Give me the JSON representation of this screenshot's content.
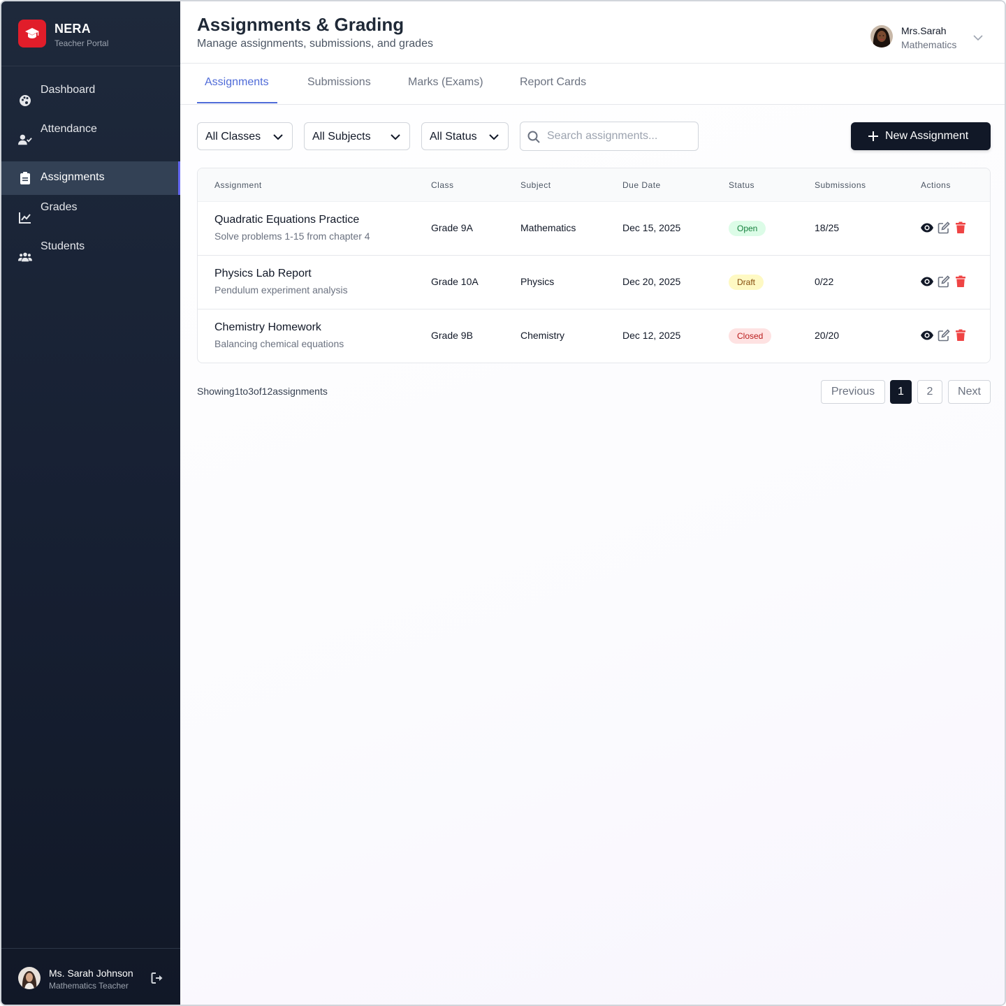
{
  "brand": {
    "name": "NERA",
    "subtitle": "Teacher Portal"
  },
  "sidebar": {
    "items": [
      {
        "label": "Dashboard",
        "icon": "palette-icon"
      },
      {
        "label": "Attendance",
        "icon": "user-check-icon"
      },
      {
        "label": "Assignments",
        "icon": "clipboard-icon",
        "active": true
      },
      {
        "label": "Grades",
        "icon": "chart-line-icon"
      },
      {
        "label": "Students",
        "icon": "users-icon"
      }
    ],
    "user": {
      "name": "Ms. Sarah Johnson",
      "role": "Mathematics Teacher"
    }
  },
  "header": {
    "title": "Assignments & Grading",
    "subtitle": "Manage assignments, submissions, and grades",
    "profile": {
      "name": "Mrs.Sarah",
      "department": "Mathematics"
    }
  },
  "tabs": [
    {
      "label": "Assignments",
      "active": true
    },
    {
      "label": "Submissions"
    },
    {
      "label": "Marks (Exams)"
    },
    {
      "label": "Report Cards"
    }
  ],
  "filters": {
    "classes": "All Classes",
    "subjects": "All Subjects",
    "status": "All Status",
    "search_placeholder": "Search assignments...",
    "new_button": "New Assignment"
  },
  "table": {
    "columns": [
      "Assignment",
      "Class",
      "Subject",
      "Due Date",
      "Status",
      "Submissions",
      "Actions"
    ],
    "rows": [
      {
        "title": "Quadratic Equations Practice",
        "desc": "Solve problems 1-15 from chapter 4",
        "class": "Grade 9A",
        "subject": "Mathematics",
        "due": "Dec 15, 2025",
        "status": "Open",
        "submissions": "18/25"
      },
      {
        "title": "Physics Lab Report",
        "desc": "Pendulum experiment analysis",
        "class": "Grade 10A",
        "subject": "Physics",
        "due": "Dec 20, 2025",
        "status": "Draft",
        "submissions": "0/22"
      },
      {
        "title": "Chemistry Homework",
        "desc": "Balancing chemical equations",
        "class": "Grade 9B",
        "subject": "Chemistry",
        "due": "Dec 12, 2025",
        "status": "Closed",
        "submissions": "20/20"
      }
    ]
  },
  "pagination": {
    "showing_prefix": "Showing",
    "from": "1",
    "to_word": "to",
    "to": "3",
    "of_word": "of",
    "total": "12",
    "suffix": "assignments",
    "previous": "Previous",
    "pages": [
      "1",
      "2"
    ],
    "next": "Next"
  },
  "colors": {
    "accent": "#4f6bd8",
    "brand": "#e11d2a",
    "open_bg": "#dcfce7",
    "open_fg": "#15803d",
    "draft_bg": "#fef9c3",
    "draft_fg": "#854d0e",
    "closed_bg": "#fee2e2",
    "closed_fg": "#b91c1c"
  }
}
